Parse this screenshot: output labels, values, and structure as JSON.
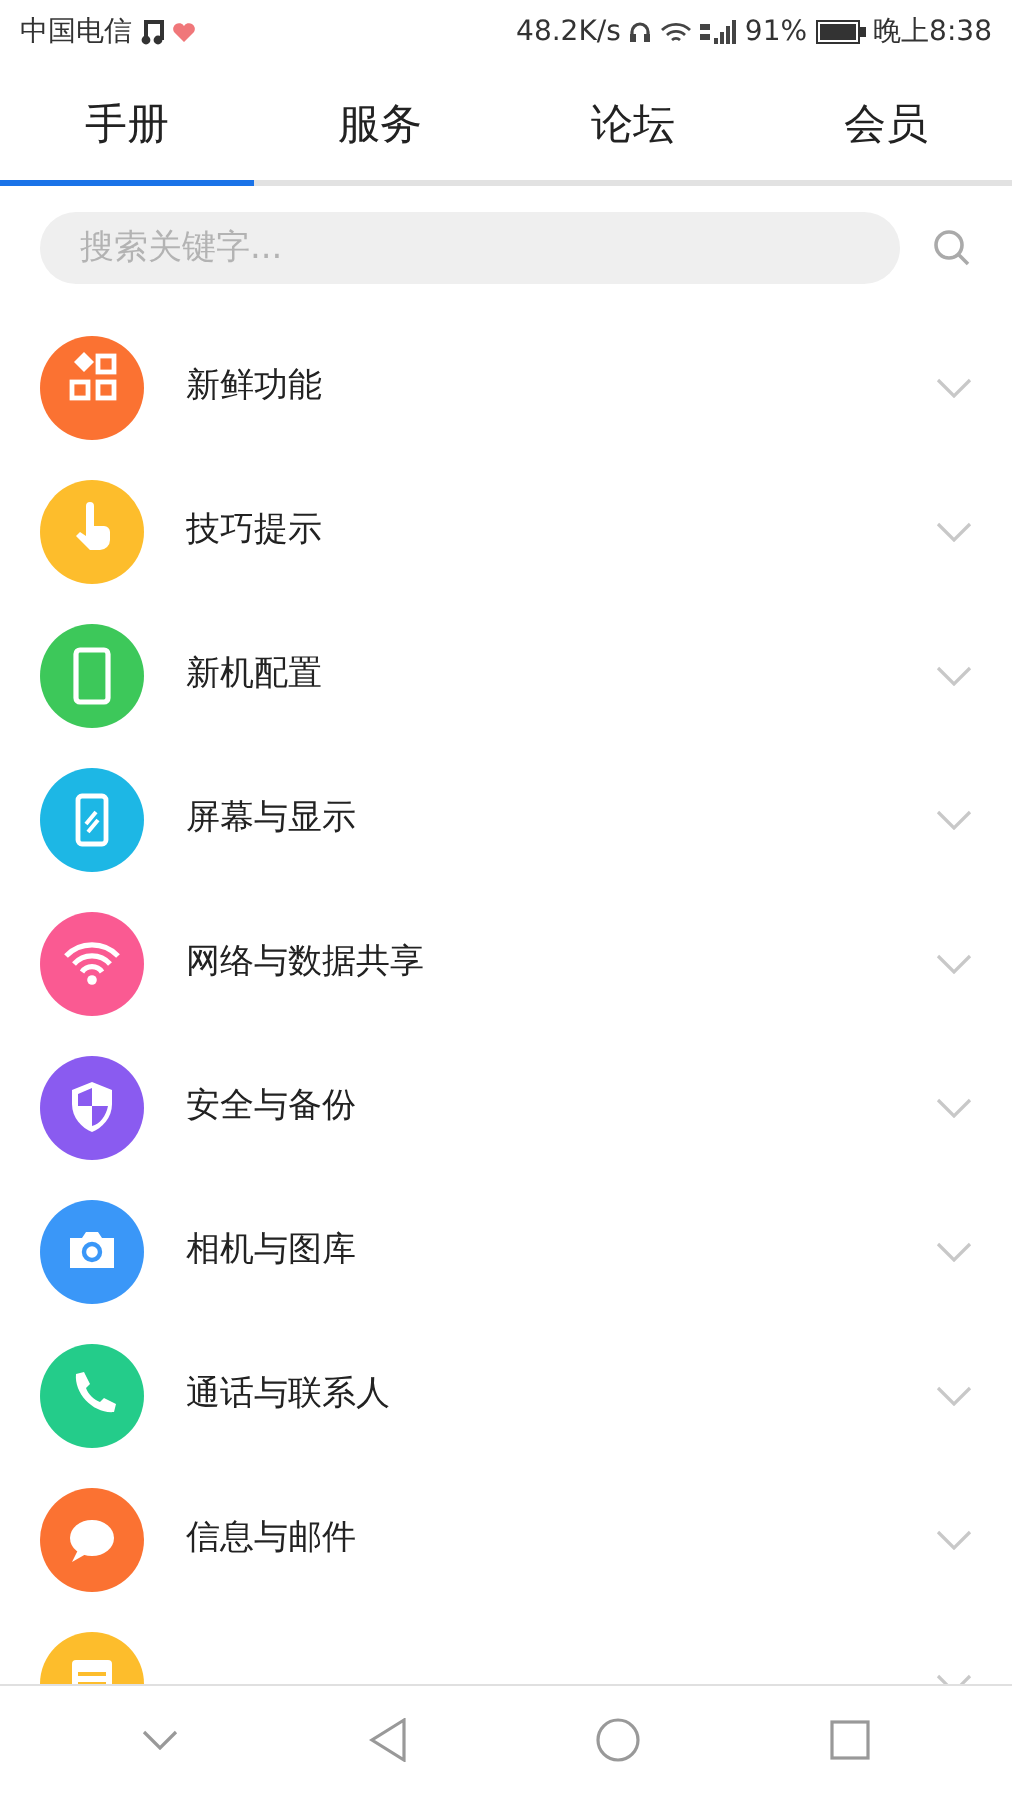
{
  "status_bar": {
    "carrier": "中国电信",
    "speed": "48.2K/s",
    "battery": "91%",
    "time": "晚上8:38"
  },
  "tabs": [
    {
      "label": "手册",
      "selected": true
    },
    {
      "label": "服务",
      "selected": false
    },
    {
      "label": "论坛",
      "selected": false
    },
    {
      "label": "会员",
      "selected": false
    }
  ],
  "search": {
    "placeholder": "搜索关键字..."
  },
  "items": [
    {
      "label": "新鲜功能",
      "kind": "apps",
      "color": "#fb7232"
    },
    {
      "label": "技巧提示",
      "kind": "hand",
      "color": "#fdbd2c"
    },
    {
      "label": "新机配置",
      "kind": "phone",
      "color": "#3dc85a"
    },
    {
      "label": "屏幕与显示",
      "kind": "screen",
      "color": "#1db7e5"
    },
    {
      "label": "网络与数据共享",
      "kind": "wifi",
      "color": "#fa5a92"
    },
    {
      "label": "安全与备份",
      "kind": "shield",
      "color": "#8a5bf0"
    },
    {
      "label": "相机与图库",
      "kind": "camera",
      "color": "#3a97f8"
    },
    {
      "label": "通话与联系人",
      "kind": "call",
      "color": "#24cc8a"
    },
    {
      "label": "信息与邮件",
      "kind": "chat",
      "color": "#fb7232"
    },
    {
      "kind": "calendar",
      "color": "#fdbd2c"
    }
  ]
}
